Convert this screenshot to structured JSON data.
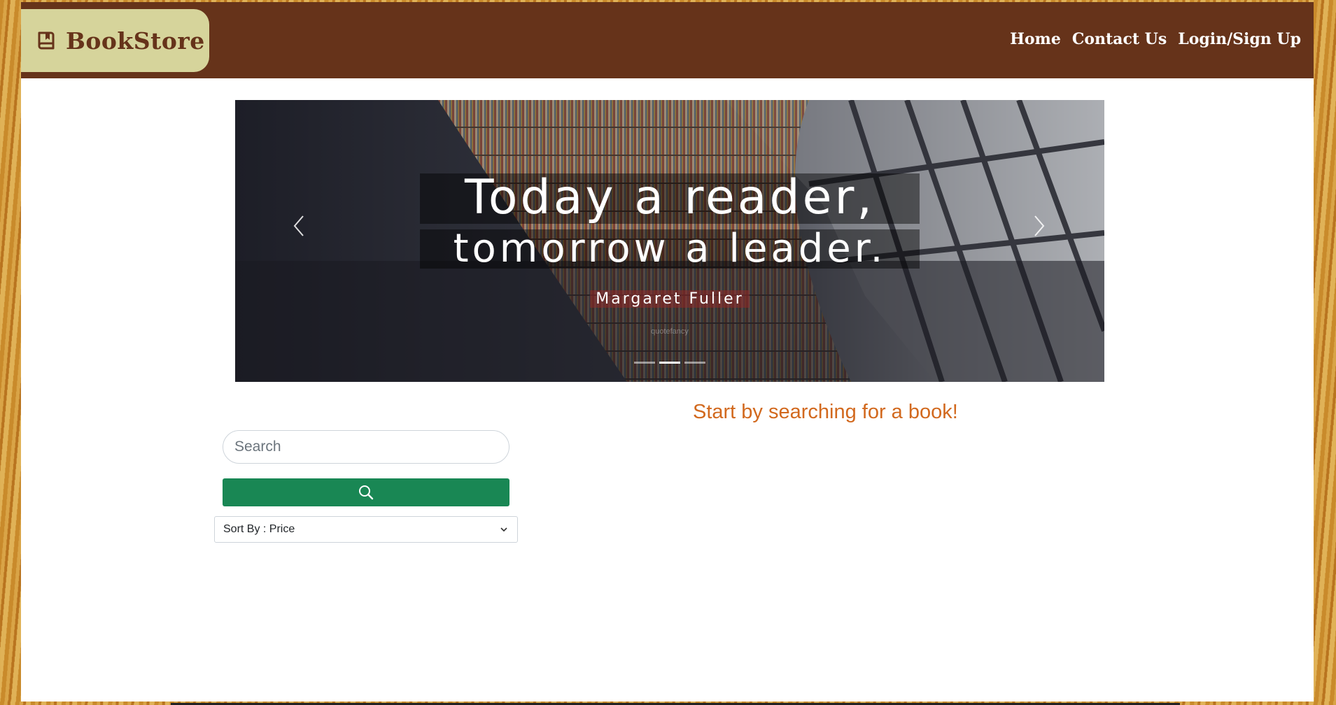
{
  "brand": {
    "name": "BookStore",
    "icon": "book-icon",
    "colors": {
      "navbar": "#66331a",
      "brand_badge": "#d6d49b"
    }
  },
  "nav": {
    "links": [
      "Home",
      "Contact Us",
      "Login/Sign Up"
    ]
  },
  "carousel": {
    "quote_line1": "Today a reader,",
    "quote_line2": "tomorrow a leader.",
    "author": "Margaret Fuller",
    "watermark": "quotefancy",
    "slide_count": 3,
    "active_slide": 2,
    "prev_icon": "chevron-left-icon",
    "next_icon": "chevron-right-icon"
  },
  "search": {
    "prompt": "Start by searching for a book!",
    "placeholder": "Search",
    "value": "",
    "button_icon": "search-icon",
    "button_color": "#198754",
    "prompt_color": "#d2691e"
  },
  "sort": {
    "selected": "Sort By : Price"
  }
}
